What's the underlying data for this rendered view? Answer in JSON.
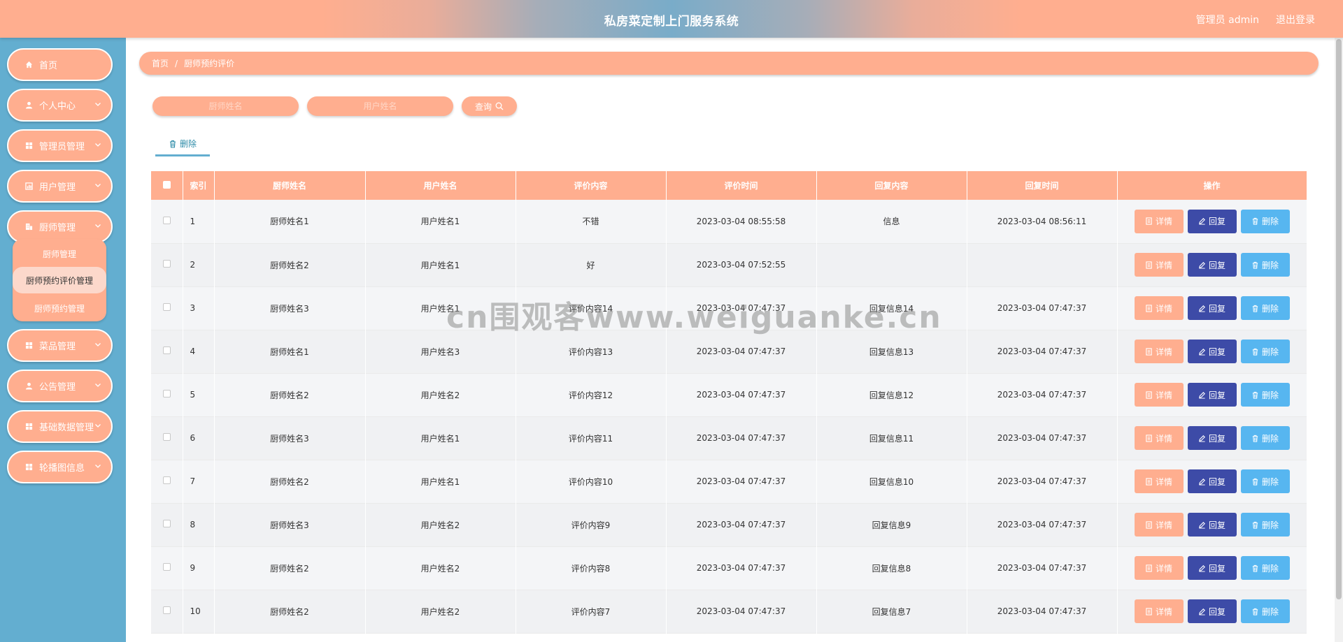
{
  "header": {
    "title": "私房菜定制上门服务系统",
    "admin": "管理员 admin",
    "logout": "退出登录"
  },
  "colors": {
    "accent": "#ffae8f",
    "sidebar": "#63aed0",
    "reply": "#3d4ba7",
    "delete": "#57b6f0"
  },
  "sidebar": {
    "items": [
      {
        "label": "首页",
        "icon": "home-icon"
      },
      {
        "label": "个人中心",
        "icon": "user-icon"
      },
      {
        "label": "管理员管理",
        "icon": "grid-icon"
      },
      {
        "label": "用户管理",
        "icon": "chart-icon"
      },
      {
        "label": "厨师管理",
        "icon": "building-icon"
      },
      {
        "label": "菜品管理",
        "icon": "grid-icon"
      },
      {
        "label": "公告管理",
        "icon": "user-icon"
      },
      {
        "label": "基础数据管理",
        "icon": "grid-icon"
      },
      {
        "label": "轮播图信息",
        "icon": "grid-icon"
      }
    ],
    "submenu": [
      "厨师管理",
      "厨师预约评价管理",
      "厨师预约管理"
    ]
  },
  "breadcrumb": {
    "home": "首页",
    "sep": "/",
    "current": "厨师预约评价"
  },
  "search": {
    "chef_placeholder": "厨师姓名",
    "user_placeholder": "用户姓名",
    "query_label": "查询"
  },
  "toolbar": {
    "delete_label": "删除"
  },
  "table": {
    "headers": [
      "索引",
      "厨师姓名",
      "用户姓名",
      "评价内容",
      "评价时间",
      "回复内容",
      "回复时间",
      "操作"
    ],
    "rows": [
      {
        "index": "1",
        "chef": "厨师姓名1",
        "user": "用户姓名1",
        "content": "不错",
        "time": "2023-03-04 08:55:58",
        "reply": "信息",
        "reply_time": "2023-03-04 08:56:11"
      },
      {
        "index": "2",
        "chef": "厨师姓名2",
        "user": "用户姓名1",
        "content": "好",
        "time": "2023-03-04 07:52:55",
        "reply": "",
        "reply_time": ""
      },
      {
        "index": "3",
        "chef": "厨师姓名3",
        "user": "用户姓名1",
        "content": "评价内容14",
        "time": "2023-03-04 07:47:37",
        "reply": "回复信息14",
        "reply_time": "2023-03-04 07:47:37"
      },
      {
        "index": "4",
        "chef": "厨师姓名1",
        "user": "用户姓名3",
        "content": "评价内容13",
        "time": "2023-03-04 07:47:37",
        "reply": "回复信息13",
        "reply_time": "2023-03-04 07:47:37"
      },
      {
        "index": "5",
        "chef": "厨师姓名2",
        "user": "用户姓名2",
        "content": "评价内容12",
        "time": "2023-03-04 07:47:37",
        "reply": "回复信息12",
        "reply_time": "2023-03-04 07:47:37"
      },
      {
        "index": "6",
        "chef": "厨师姓名3",
        "user": "用户姓名1",
        "content": "评价内容11",
        "time": "2023-03-04 07:47:37",
        "reply": "回复信息11",
        "reply_time": "2023-03-04 07:47:37"
      },
      {
        "index": "7",
        "chef": "厨师姓名2",
        "user": "用户姓名1",
        "content": "评价内容10",
        "time": "2023-03-04 07:47:37",
        "reply": "回复信息10",
        "reply_time": "2023-03-04 07:47:37"
      },
      {
        "index": "8",
        "chef": "厨师姓名3",
        "user": "用户姓名2",
        "content": "评价内容9",
        "time": "2023-03-04 07:47:37",
        "reply": "回复信息9",
        "reply_time": "2023-03-04 07:47:37"
      },
      {
        "index": "9",
        "chef": "厨师姓名2",
        "user": "用户姓名2",
        "content": "评价内容8",
        "time": "2023-03-04 07:47:37",
        "reply": "回复信息8",
        "reply_time": "2023-03-04 07:47:37"
      },
      {
        "index": "10",
        "chef": "厨师姓名2",
        "user": "用户姓名2",
        "content": "评价内容7",
        "time": "2023-03-04 07:47:37",
        "reply": "回复信息7",
        "reply_time": "2023-03-04 07:47:37"
      }
    ],
    "actions": {
      "detail": "详情",
      "reply": "回复",
      "delete": "删除"
    }
  },
  "watermark": "cn围观客www.weiguanke.cn"
}
